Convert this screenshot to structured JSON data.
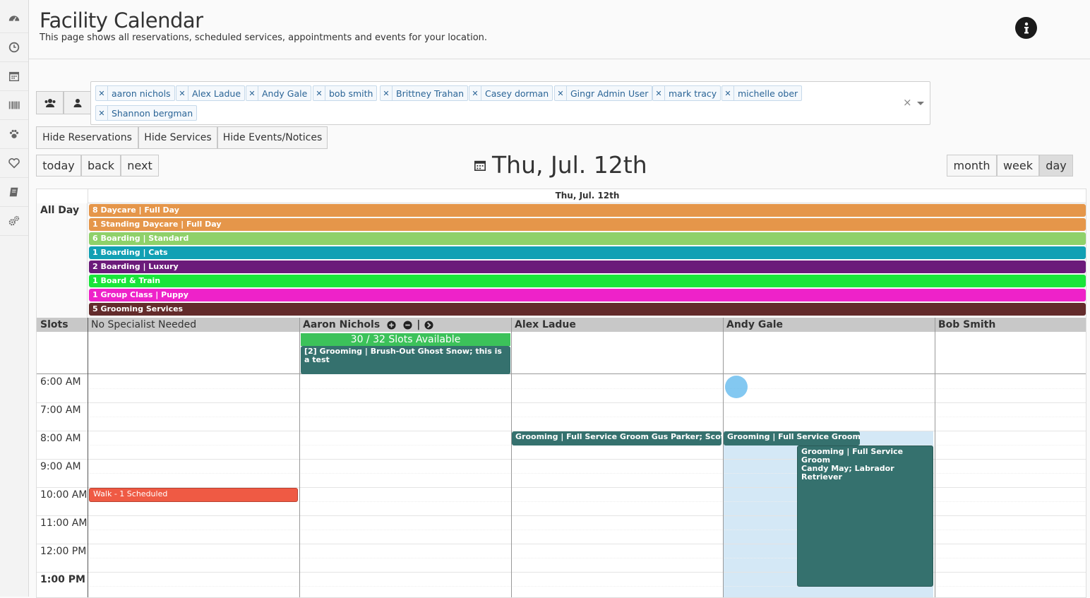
{
  "header": {
    "title": "Facility Calendar",
    "subtitle": "This page shows all reservations, scheduled services, appointments and events for your location."
  },
  "sidebar": {
    "items": [
      "dashboard-icon",
      "clock-icon",
      "calendar-icon",
      "barcode-icon",
      "paw-icon",
      "heart-icon",
      "book-icon",
      "gears-icon"
    ]
  },
  "filters": {
    "tags": [
      "aaron nichols",
      "Alex Ladue",
      "Andy Gale",
      "bob smith",
      "Brittney Trahan",
      "Casey dorman",
      "Gingr Admin User",
      "mark tracy",
      "michelle ober",
      "Shannon bergman"
    ],
    "clear": "×"
  },
  "toggles": {
    "hide_reservations": "Hide Reservations",
    "hide_services": "Hide Services",
    "hide_events": "Hide Events/Notices"
  },
  "nav": {
    "today": "today",
    "back": "back",
    "next": "next",
    "month": "month",
    "week": "week",
    "day": "day"
  },
  "calendar": {
    "heading": "Thu, Jul. 12th",
    "day_header": "Thu, Jul. 12th",
    "all_day_label": "All Day",
    "all_day_events": [
      {
        "label": "8 Daycare | Full Day",
        "color": "#e5964a"
      },
      {
        "label": "1 Standing Daycare | Full Day",
        "color": "#e5964a"
      },
      {
        "label": "6 Boarding | Standard",
        "color": "#8fd16a"
      },
      {
        "label": "1 Boarding | Cats",
        "color": "#11a0b4"
      },
      {
        "label": "2 Boarding | Luxury",
        "color": "#6b1b7a"
      },
      {
        "label": "1 Board & Train",
        "color": "#19e53a"
      },
      {
        "label": "1 Group Class | Puppy",
        "color": "#ee22c9"
      },
      {
        "label": "5 Grooming Services",
        "color": "#632b2b"
      }
    ],
    "resources": {
      "slots": "Slots",
      "none": "No Specialist Needed",
      "aaron": "Aaron Nichols",
      "alex": "Alex Ladue",
      "andy": "Andy Gale",
      "bob": "Bob Smith"
    },
    "slots_available": "30 / 32 Slots Available",
    "times": [
      "6:00 AM",
      "7:00 AM",
      "8:00 AM",
      "9:00 AM",
      "10:00 AM",
      "11:00 AM",
      "12:00 PM",
      "1:00 PM"
    ],
    "events": {
      "aaron_slot": "[2] Grooming | Brush-Out Ghost Snow; this is a test",
      "alex_groom": "Grooming | Full Service Groom Gus Parker; Scottish Terrier",
      "andy_groom1": "Grooming | Full Service Groom Jimmy Tahoe; Basset Hound",
      "andy_groom2_title": "Grooming | Full Service Groom",
      "andy_groom2_sub": "Candy May; Labrador Retriever",
      "walk": "Walk - 1 Scheduled"
    },
    "colors": {
      "teal": "#35716e",
      "walk": "#ef5a44",
      "slots": "#3cc25a",
      "highlight": "#d4e8f6"
    }
  }
}
